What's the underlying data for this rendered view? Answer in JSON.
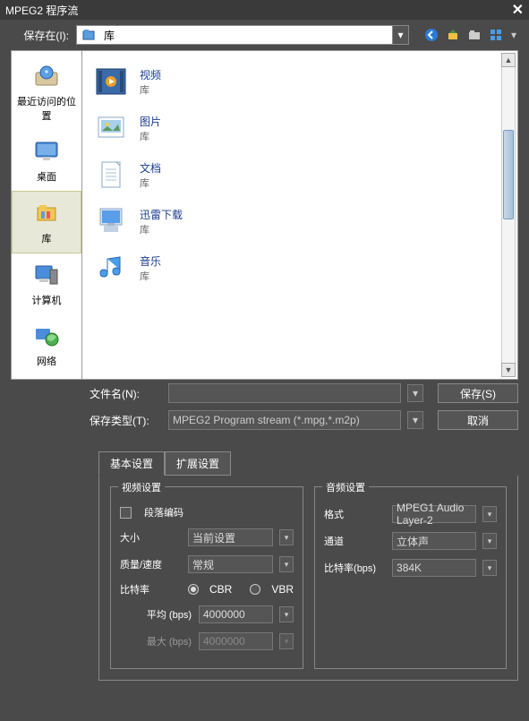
{
  "title": "MPEG2 程序流",
  "saveIn": {
    "label": "保存在(I):",
    "value": "库"
  },
  "places": [
    {
      "label": "最近访问的位置"
    },
    {
      "label": "桌面"
    },
    {
      "label": "库",
      "selected": true
    },
    {
      "label": "计算机"
    },
    {
      "label": "网络"
    }
  ],
  "items": [
    {
      "name": "视频",
      "sub": "库"
    },
    {
      "name": "图片",
      "sub": "库"
    },
    {
      "name": "文档",
      "sub": "库"
    },
    {
      "name": "迅雷下载",
      "sub": "库"
    },
    {
      "name": "音乐",
      "sub": "库"
    }
  ],
  "fileName": {
    "label": "文件名(N):",
    "value": ""
  },
  "fileType": {
    "label": "保存类型(T):",
    "value": "MPEG2 Program stream (*.mpg,*.m2p)"
  },
  "buttons": {
    "save": "保存(S)",
    "cancel": "取消"
  },
  "tabs": {
    "basic": "基本设置",
    "advanced": "扩展设置"
  },
  "video": {
    "legend": "视频设置",
    "segenc": "段落编码",
    "size": {
      "label": "大小",
      "value": "当前设置"
    },
    "quality": {
      "label": "质量/速度",
      "value": "常规"
    },
    "bitrate": {
      "label": "比特率",
      "cbr": "CBR",
      "vbr": "VBR"
    },
    "avg": {
      "label": "平均 (bps)",
      "value": "4000000"
    },
    "max": {
      "label": "最大 (bps)",
      "value": "4000000"
    }
  },
  "audio": {
    "legend": "音频设置",
    "format": {
      "label": "格式",
      "value": "MPEG1 Audio Layer-2"
    },
    "channel": {
      "label": "通道",
      "value": "立体声"
    },
    "bitrate": {
      "label": "比特率(bps)",
      "value": "384K"
    }
  }
}
